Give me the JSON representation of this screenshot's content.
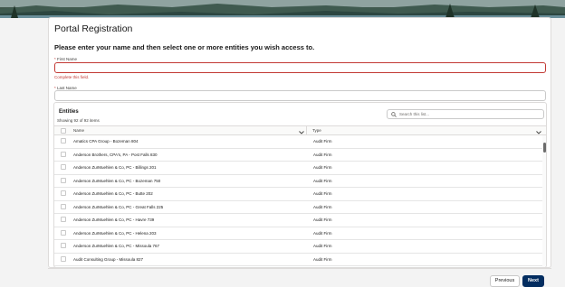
{
  "form": {
    "title": "Portal Registration",
    "instructions": "Please enter your name and then select one or more entities you wish access to.",
    "first_name_label": "First Name",
    "first_name_value": "",
    "first_name_error": "Complete this field.",
    "last_name_label": "Last Name",
    "last_name_value": "",
    "required_marker": "*"
  },
  "entities": {
    "title": "Entities",
    "count": "Showing 92 of 92 items",
    "search_placeholder": "Search this list...",
    "columns": [
      "Name",
      "Type"
    ],
    "rows": [
      {
        "name": "Amatics CPA Group - Bozeman 804",
        "type": "Audit Firm"
      },
      {
        "name": "Anderson Brothers, CPA's, PA - Post Falls 830",
        "type": "Audit Firm"
      },
      {
        "name": "Anderson ZurMuehlen & Co, PC - Billings 201",
        "type": "Audit Firm"
      },
      {
        "name": "Anderson ZurMuehlen & Co, PC - Bozeman 750",
        "type": "Audit Firm"
      },
      {
        "name": "Anderson ZurMuehlen & Co, PC - Butte 202",
        "type": "Audit Firm"
      },
      {
        "name": "Anderson ZurMuehlen & Co, PC - Great Falls 225",
        "type": "Audit Firm"
      },
      {
        "name": "Anderson ZurMuehlen & Co, PC - Havre 739",
        "type": "Audit Firm"
      },
      {
        "name": "Anderson ZurMuehlen & Co, PC - Helena 203",
        "type": "Audit Firm"
      },
      {
        "name": "Anderson ZurMuehlen & Co, PC - Missoula 767",
        "type": "Audit Firm"
      },
      {
        "name": "Audit Consulting Group - Missoula 827",
        "type": "Audit Firm"
      }
    ]
  },
  "buttons": {
    "previous": "Previous",
    "next": "Next"
  },
  "colors": {
    "error": "#c23934",
    "primary_button": "#032d60"
  }
}
